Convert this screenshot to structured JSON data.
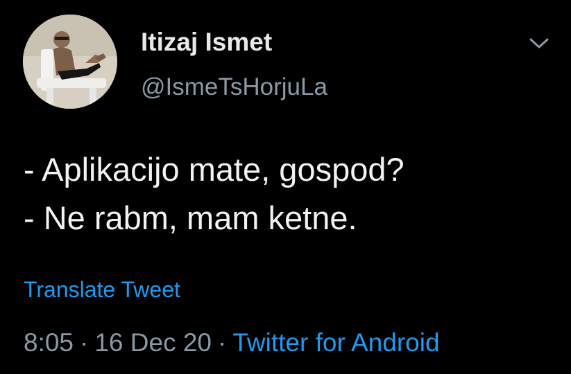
{
  "author": {
    "display_name": "Itizaj Ismet",
    "handle": "@IsmeTsHorjuLa"
  },
  "tweet": {
    "lines": [
      "- Aplikacijo mate, gospod?",
      "- Ne rabm, mam ketne."
    ],
    "translate_label": "Translate Tweet",
    "time": "8:05",
    "separator": "·",
    "date": "16 Dec 20",
    "source": "Twitter for Android"
  },
  "icons": {
    "more": "chevron-down-icon",
    "avatar": "profile-photo"
  },
  "colors": {
    "background": "#000000",
    "text": "#e7e9ea",
    "secondary": "#8b98a5",
    "link": "#1d9bf0"
  }
}
